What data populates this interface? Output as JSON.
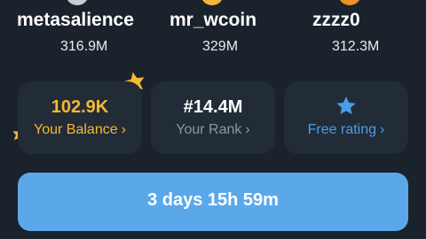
{
  "leaderboard": [
    {
      "name": "metasalience",
      "score": "316.9M",
      "avatar_color": "#c9ccd1"
    },
    {
      "name": "mr_wcoin",
      "score": "329M",
      "avatar_color": "#f2b63a"
    },
    {
      "name": "zzzz0",
      "score": "312.3M",
      "avatar_color": "#f0902a"
    }
  ],
  "stats": {
    "balance": {
      "value": "102.9K",
      "label": "Your Balance",
      "color": "#f5b931"
    },
    "rank": {
      "value": "#14.4M",
      "label": "Your Rank"
    },
    "rating": {
      "label": "Free rating",
      "color": "#4b9de8"
    }
  },
  "timer": {
    "text": "3 days 15h 59m",
    "color": "#5aa8ea"
  },
  "icons": {
    "chevron": "chevron-right-icon",
    "star": "star-icon"
  }
}
